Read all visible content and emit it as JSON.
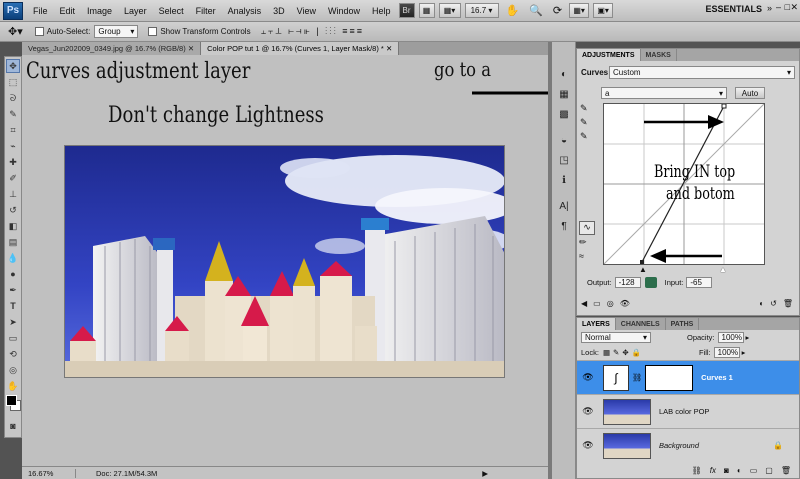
{
  "menubar": {
    "logo": "Ps",
    "items": [
      "File",
      "Edit",
      "Image",
      "Layer",
      "Select",
      "Filter",
      "Analysis",
      "3D",
      "View",
      "Window",
      "Help"
    ],
    "bridge": "Br",
    "zoom": "16.7",
    "workspace": "ESSENTIALS"
  },
  "options": {
    "auto_select_label": "Auto-Select:",
    "auto_select_value": "Group",
    "show_transform_label": "Show Transform Controls"
  },
  "doc_tabs": [
    {
      "label": "Vegas_Jun202009_0349.jpg @ 16.7% (RGB/8)"
    },
    {
      "label": "Color POP tut 1 @ 16.7% (Curves 1, Layer Mask/8) *"
    }
  ],
  "annotations": {
    "title": "Curves adjustment layer",
    "subtitle": "Don't change Lightness",
    "goto": "go to a",
    "bring1": "Bring IN top",
    "bring2": "and botom"
  },
  "status": {
    "zoom": "16.67%",
    "doc": "Doc: 27.1M/54.3M"
  },
  "adjustments": {
    "tab_adjustments": "ADJUSTMENTS",
    "tab_masks": "MASKS",
    "preset_label": "Curves",
    "preset_value": "Custom",
    "channel_value": "a",
    "auto_label": "Auto",
    "output_label": "Output:",
    "output_value": "-128",
    "input_label": "Input:",
    "input_value": "-65"
  },
  "layers": {
    "tab_layers": "LAYERS",
    "tab_channels": "CHANNELS",
    "tab_paths": "PATHS",
    "blend_mode": "Normal",
    "opacity_label": "Opacity:",
    "opacity_value": "100%",
    "lock_label": "Lock:",
    "fill_label": "Fill:",
    "fill_value": "100%",
    "items": [
      {
        "name": "Curves 1",
        "selected": true
      },
      {
        "name": "LAB color POP",
        "selected": false
      },
      {
        "name": "Background",
        "selected": false
      }
    ]
  }
}
